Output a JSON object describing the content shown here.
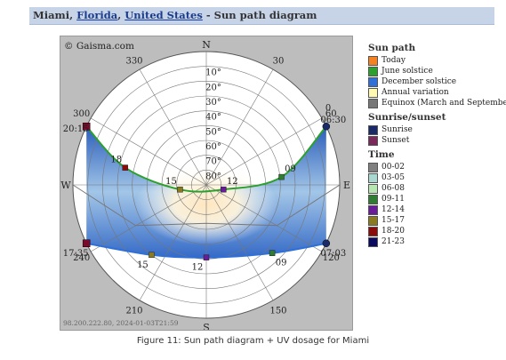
{
  "header": {
    "city": "Miami",
    "sep1": ", ",
    "region": "Florida",
    "sep2": ", ",
    "country": "United States",
    "suffix": " - Sun path diagram"
  },
  "copyright": "© Gaisma.com",
  "footer_stamp": "98.200.222.80, 2024-01-03T21:59",
  "caption": "Figure 11: Sun path diagram + UV dosage for Miami",
  "chart_data": {
    "type": "polar",
    "compass": {
      "N": "N",
      "E": "E",
      "S": "S",
      "W": "W"
    },
    "altitude_labels": [
      "10°",
      "20°",
      "30°",
      "40°",
      "50°",
      "60°",
      "70°",
      "80°"
    ],
    "azimuth_labels": [
      {
        "az": 30,
        "label": "30"
      },
      {
        "az": 60,
        "label": "60"
      },
      {
        "az": 120,
        "label": "120"
      },
      {
        "az": 150,
        "label": "150"
      },
      {
        "az": 210,
        "label": "210"
      },
      {
        "az": 240,
        "label": "240"
      },
      {
        "az": 300,
        "label": "300"
      },
      {
        "az": 330,
        "label": "330"
      }
    ],
    "june_solstice": {
      "name": "June solstice",
      "color": "#2ca02c",
      "sunrise": {
        "label": "06:30",
        "az": 64,
        "alt": 0
      },
      "sunset": {
        "label": "20:15",
        "az": 296,
        "alt": 0
      },
      "hours": [
        {
          "label": "09",
          "az": 84,
          "alt": 39
        },
        {
          "label": "12",
          "az": 105,
          "alt": 78
        },
        {
          "label": "15",
          "az": 260,
          "alt": 72
        },
        {
          "label": "18",
          "az": 282,
          "alt": 34
        }
      ]
    },
    "december_solstice": {
      "name": "December solstice",
      "color": "#2f6fd8",
      "sunrise": {
        "label": "07:03",
        "az": 116,
        "alt": 0
      },
      "sunset": {
        "label": "17:35",
        "az": 244,
        "alt": 0
      },
      "hours": [
        {
          "label": "09",
          "az": 136,
          "alt": 26
        },
        {
          "label": "12",
          "az": 180,
          "alt": 41
        },
        {
          "label": "15",
          "az": 218,
          "alt": 30
        }
      ]
    },
    "extra_hour_labels": [
      {
        "label": "0",
        "az": 60,
        "alt": 2
      }
    ],
    "legend": {
      "sun_path": {
        "title": "Sun path",
        "items": [
          {
            "label": "Today",
            "color": "#f58220"
          },
          {
            "label": "June solstice",
            "color": "#2ca02c"
          },
          {
            "label": "December solstice",
            "color": "#2f6fd8"
          },
          {
            "label": "Annual variation",
            "color": "#fff8b0"
          },
          {
            "label": "Equinox (March and September)",
            "color": "#777777"
          }
        ]
      },
      "sunrise_sunset": {
        "title": "Sunrise/sunset",
        "items": [
          {
            "label": "Sunrise",
            "color": "#1a2a66"
          },
          {
            "label": "Sunset",
            "color": "#7a2a5a"
          }
        ]
      },
      "time": {
        "title": "Time",
        "items": [
          {
            "label": "00-02",
            "color": "#808080"
          },
          {
            "label": "03-05",
            "color": "#a8d8d0"
          },
          {
            "label": "06-08",
            "color": "#b8e6b0"
          },
          {
            "label": "09-11",
            "color": "#2e7d32"
          },
          {
            "label": "12-14",
            "color": "#6a1b9a"
          },
          {
            "label": "15-17",
            "color": "#8a7a20"
          },
          {
            "label": "18-20",
            "color": "#8b0a0a"
          },
          {
            "label": "21-23",
            "color": "#0a0a60"
          }
        ]
      }
    }
  }
}
